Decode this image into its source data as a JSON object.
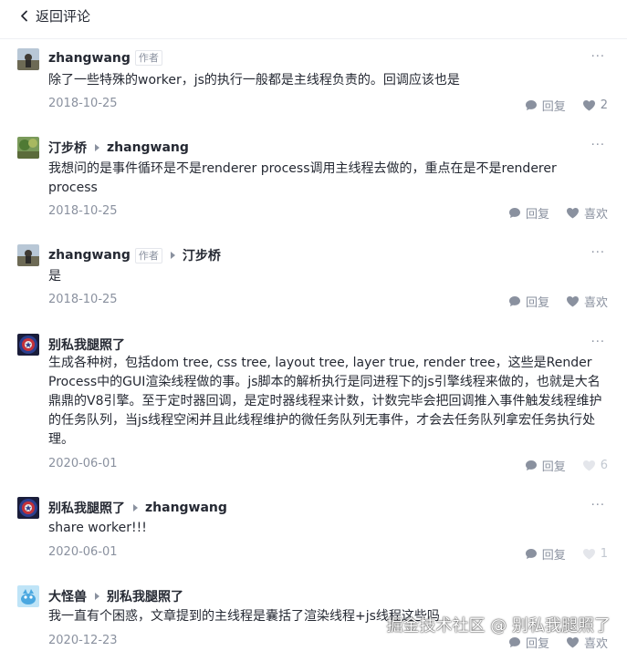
{
  "header": {
    "back_label": "返回评论"
  },
  "comments": [
    {
      "author": "zhangwang",
      "author_tag": "作者",
      "reply_to": "",
      "text": "除了一些特殊的worker，js的执行一般都是主线程负责的。回调应该也是",
      "date": "2018-10-25",
      "reply_label": "回复",
      "like_label": "2"
    },
    {
      "author": "汀步桥",
      "author_tag": "",
      "reply_to": "zhangwang",
      "text": "我想问的是事件循环是不是renderer process调用主线程去做的，重点在是不是renderer process",
      "date": "2018-10-25",
      "reply_label": "回复",
      "like_label": "喜欢"
    },
    {
      "author": "zhangwang",
      "author_tag": "作者",
      "reply_to": "汀步桥",
      "text": "是",
      "date": "2018-10-25",
      "reply_label": "回复",
      "like_label": "喜欢"
    },
    {
      "author": "别私我腿照了",
      "author_tag": "",
      "reply_to": "",
      "text": "生成各种树，包括dom tree, css tree, layout tree, layer true, render tree，这些是Render Process中的GUI渲染线程做的事。js脚本的解析执行是同进程下的js引擎线程来做的，也就是大名鼎鼎的V8引擎。至于定时器回调，是定时器线程来计数，计数完毕会把回调推入事件触发线程维护的任务队列，当js线程空闲并且此线程维护的微任务队列无事件，才会去任务队列拿宏任务执行处理。",
      "date": "2020-06-01",
      "reply_label": "回复",
      "like_label": "6"
    },
    {
      "author": "别私我腿照了",
      "author_tag": "",
      "reply_to": "zhangwang",
      "text": "share worker!!!",
      "date": "2020-06-01",
      "reply_label": "回复",
      "like_label": "1"
    },
    {
      "author": "大怪兽",
      "author_tag": "",
      "reply_to": "别私我腿照了",
      "text": "我一直有个困惑，文章提到的主线程是囊括了渲染线程+js线程这些吗",
      "date": "2020-12-23",
      "reply_label": "回复",
      "like_label": "喜欢"
    }
  ],
  "watermark": "掘金技术社区 @ 别私我腿照了",
  "colors": {
    "text": "#252933",
    "muted": "#8a919f",
    "liked": "#8a919f"
  }
}
